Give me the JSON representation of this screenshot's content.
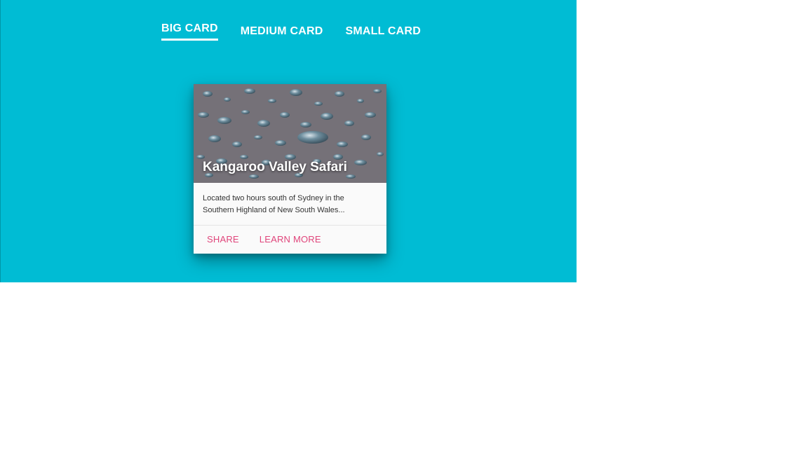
{
  "tabs": [
    {
      "label": "BIG CARD",
      "active": true
    },
    {
      "label": "MEDIUM CARD",
      "active": false
    },
    {
      "label": "SMALL CARD",
      "active": false
    }
  ],
  "card": {
    "title": "Kangaroo Valley Safari",
    "description_line1": "Located two hours south of Sydney in the",
    "description_line2": "Southern Highland of New South Wales...",
    "actions": {
      "share": "SHARE",
      "learn_more": "LEARN MORE"
    }
  },
  "colors": {
    "background": "#00bcd4",
    "accent": "#e0457b"
  }
}
